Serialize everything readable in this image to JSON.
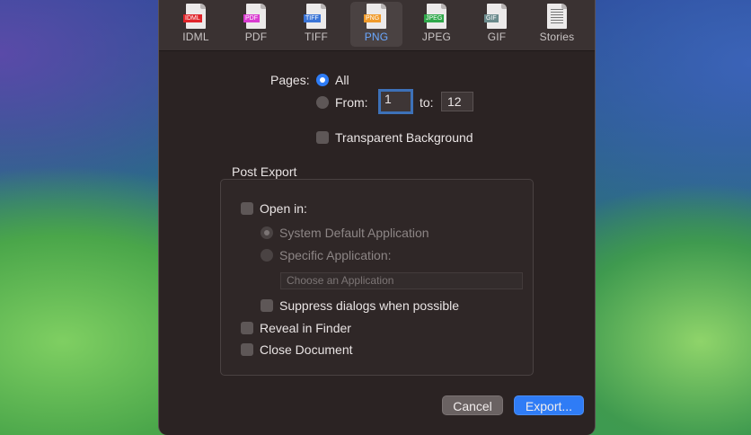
{
  "toolbar": {
    "items": [
      {
        "label": "IDML",
        "badge": "IDML",
        "badge_color": "#e0242a"
      },
      {
        "label": "PDF",
        "badge": "PDF",
        "badge_color": "#d93bd0"
      },
      {
        "label": "TIFF",
        "badge": "TIFF",
        "badge_color": "#3a74d6"
      },
      {
        "label": "PNG",
        "badge": "PNG",
        "badge_color": "#f09a2a"
      },
      {
        "label": "JPEG",
        "badge": "JPEG",
        "badge_color": "#2fa84a"
      },
      {
        "label": "GIF",
        "badge": "GIF",
        "badge_color": "#6a8a8c"
      },
      {
        "label": "Stories",
        "badge": "",
        "badge_color": ""
      }
    ],
    "active": "PNG"
  },
  "pages": {
    "label": "Pages:",
    "all_label": "All",
    "from_label": "From:",
    "from_value": "1",
    "to_label": "to:",
    "to_value": "12"
  },
  "options": {
    "transparent_label": "Transparent Background"
  },
  "post_export": {
    "title": "Post Export",
    "open_in_label": "Open in:",
    "system_default_label": "System Default Application",
    "specific_app_label": "Specific Application:",
    "choose_app_placeholder": "Choose an Application",
    "suppress_label": "Suppress dialogs when possible",
    "reveal_label": "Reveal in Finder",
    "close_doc_label": "Close Document"
  },
  "buttons": {
    "cancel": "Cancel",
    "export": "Export..."
  }
}
